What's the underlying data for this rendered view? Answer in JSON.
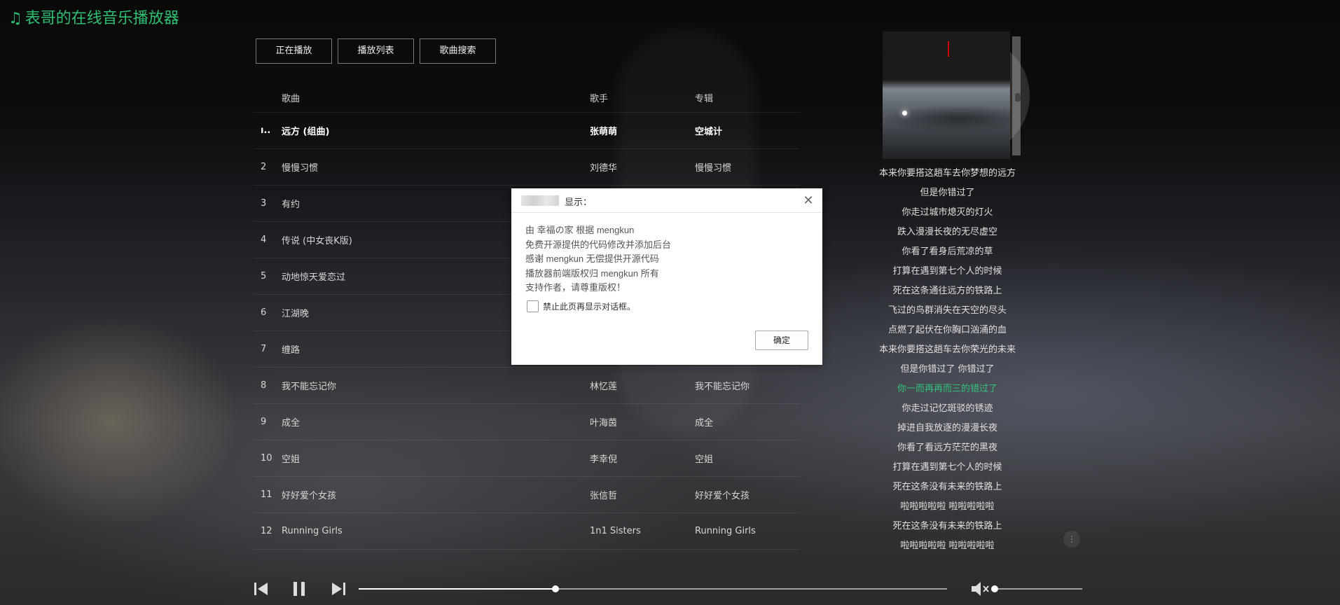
{
  "app": {
    "title": "表哥的在线音乐播放器",
    "note_icon": "music-note-icon"
  },
  "tabs": [
    {
      "label": "正在播放"
    },
    {
      "label": "播放列表"
    },
    {
      "label": "歌曲搜索"
    }
  ],
  "songlist": {
    "headers": {
      "name": "歌曲",
      "artist": "歌手",
      "album": "专辑"
    },
    "playing_indicator": "ı..",
    "rows": [
      {
        "num": "",
        "name": "远方 (组曲)",
        "artist": "张萌萌",
        "album": "空城计",
        "playing": true
      },
      {
        "num": "2",
        "name": "慢慢习惯",
        "artist": "刘德华",
        "album": "慢慢习惯"
      },
      {
        "num": "3",
        "name": "有约",
        "artist": "",
        "album": ""
      },
      {
        "num": "4",
        "name": "传说 (中女丧K版)",
        "artist": "",
        "album": ""
      },
      {
        "num": "5",
        "name": "动地惊天爱恋过",
        "artist": "",
        "album": ""
      },
      {
        "num": "6",
        "name": "江湖晚",
        "artist": "",
        "album": ""
      },
      {
        "num": "7",
        "name": "缠路",
        "artist": "",
        "album": ""
      },
      {
        "num": "8",
        "name": "我不能忘记你",
        "artist": "林忆莲",
        "album": "我不能忘记你"
      },
      {
        "num": "9",
        "name": "成全",
        "artist": "叶海茵",
        "album": "成全"
      },
      {
        "num": "10",
        "name": "空姐",
        "artist": "李幸倪",
        "album": "空姐"
      },
      {
        "num": "11",
        "name": "好好爱个女孩",
        "artist": "张信哲",
        "album": "好好爱个女孩"
      },
      {
        "num": "12",
        "name": "Running Girls",
        "artist": "1n1 Sisters",
        "album": "Running Girls"
      }
    ]
  },
  "lyrics": [
    "本来你要搭这趟车去你梦想的远方",
    "但是你错过了",
    "你走过城市熄灭的灯火",
    "跌入漫漫长夜的无尽虚空",
    "你看了看身后荒凉的草",
    "打算在遇到第七个人的时候",
    "死在这条通往远方的铁路上",
    "飞过的鸟群消失在天空的尽头",
    "点燃了起伏在你胸口汹涌的血",
    "本来你要搭这趟车去你荣光的未来",
    "但是你错过了 你错过了",
    "你一而再再而三的错过了",
    "你走过记忆斑驳的锈迹",
    "掉进自我放逐的漫漫长夜",
    "你看了看远方茫茫的黑夜",
    "打算在遇到第七个人的时候",
    "死在这条没有未来的铁路上",
    "啦啦啦啦啦 啦啦啦啦啦",
    "死在这条没有未来的铁路上",
    "啦啦啦啦啦 啦啦啦啦啦"
  ],
  "current_lyric_index": 11,
  "player": {
    "progress": 0.335,
    "volume": 0.0,
    "muted": true,
    "icons": {
      "prev": "prev-icon",
      "pause": "pause-icon",
      "next": "next-icon",
      "mute": "volume-mute-icon"
    }
  },
  "dialog": {
    "title": "显示：",
    "lines": [
      "由 幸福の家 根据 mengkun",
      "免费开源提供的代码修改并添加后台",
      "感谢 mengkun 无偿提供开源代码",
      "播放器前端版权归 mengkun 所有",
      "支持作者，请尊重版权！"
    ],
    "checkbox_label": "禁止此页再显示对话框。",
    "ok_label": "确定",
    "close_icon": "close-icon"
  },
  "colors": {
    "brand": "#2fbf71",
    "lyric_active": "#31c27c"
  }
}
